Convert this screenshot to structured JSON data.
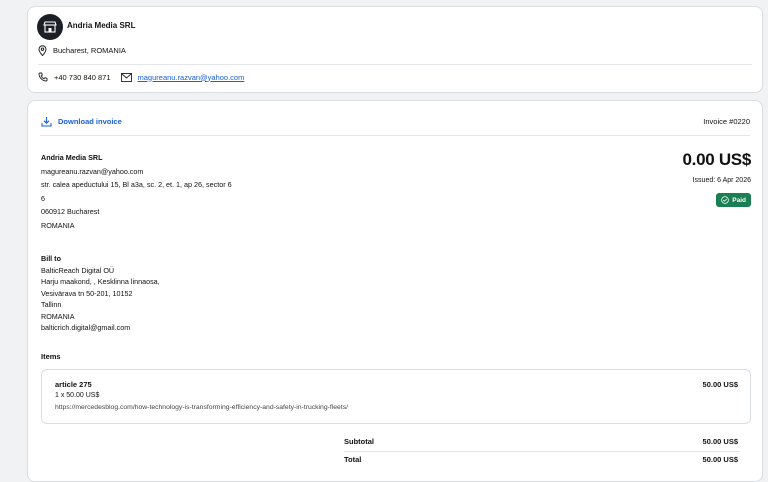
{
  "vendor": {
    "name": "Andria Media SRL",
    "location": "Bucharest, ROMANIA",
    "phone": "+40 730 840 871",
    "email": "magureanu.razvan@yahoo.com"
  },
  "invoice": {
    "download_label": "Download invoice",
    "number": "Invoice #0220",
    "amount": "0.00 US$",
    "issued": "Issued: 6 Apr 2026",
    "status": "Paid",
    "status_color": "#1a7f52"
  },
  "seller": {
    "name": "Andria Media SRL",
    "lines": [
      "magureanu.razvan@yahoo.com",
      "str. calea apeductului 15, Bl a3a, sc. 2, et. 1, ap 26, sector 6",
      "6",
      "060912 Bucharest",
      "ROMANIA"
    ]
  },
  "bill_to": {
    "heading": "Bill to",
    "lines": [
      "BalticReach Digital OÜ",
      "Harju maakond, , Kesklinna linnaosa,",
      "Vesivärava tn 50-201, 10152",
      "Tallinn",
      "ROMANIA",
      "balticrich.digital@gmail.com"
    ]
  },
  "items": {
    "heading": "Items",
    "list": [
      {
        "name": "article 275",
        "qty": "1 x 50.00 US$",
        "url": "https://mercedesblog.com/how-technology-is-transforming-efficiency-and-safety-in-trucking-fleets/",
        "price": "50.00 US$"
      }
    ]
  },
  "totals": {
    "subtotal_label": "Subtotal",
    "subtotal": "50.00 US$",
    "total_label": "Total",
    "total": "50.00 US$"
  },
  "colors": {
    "link": "#1a5fd6",
    "background": "#f1f2f4"
  }
}
